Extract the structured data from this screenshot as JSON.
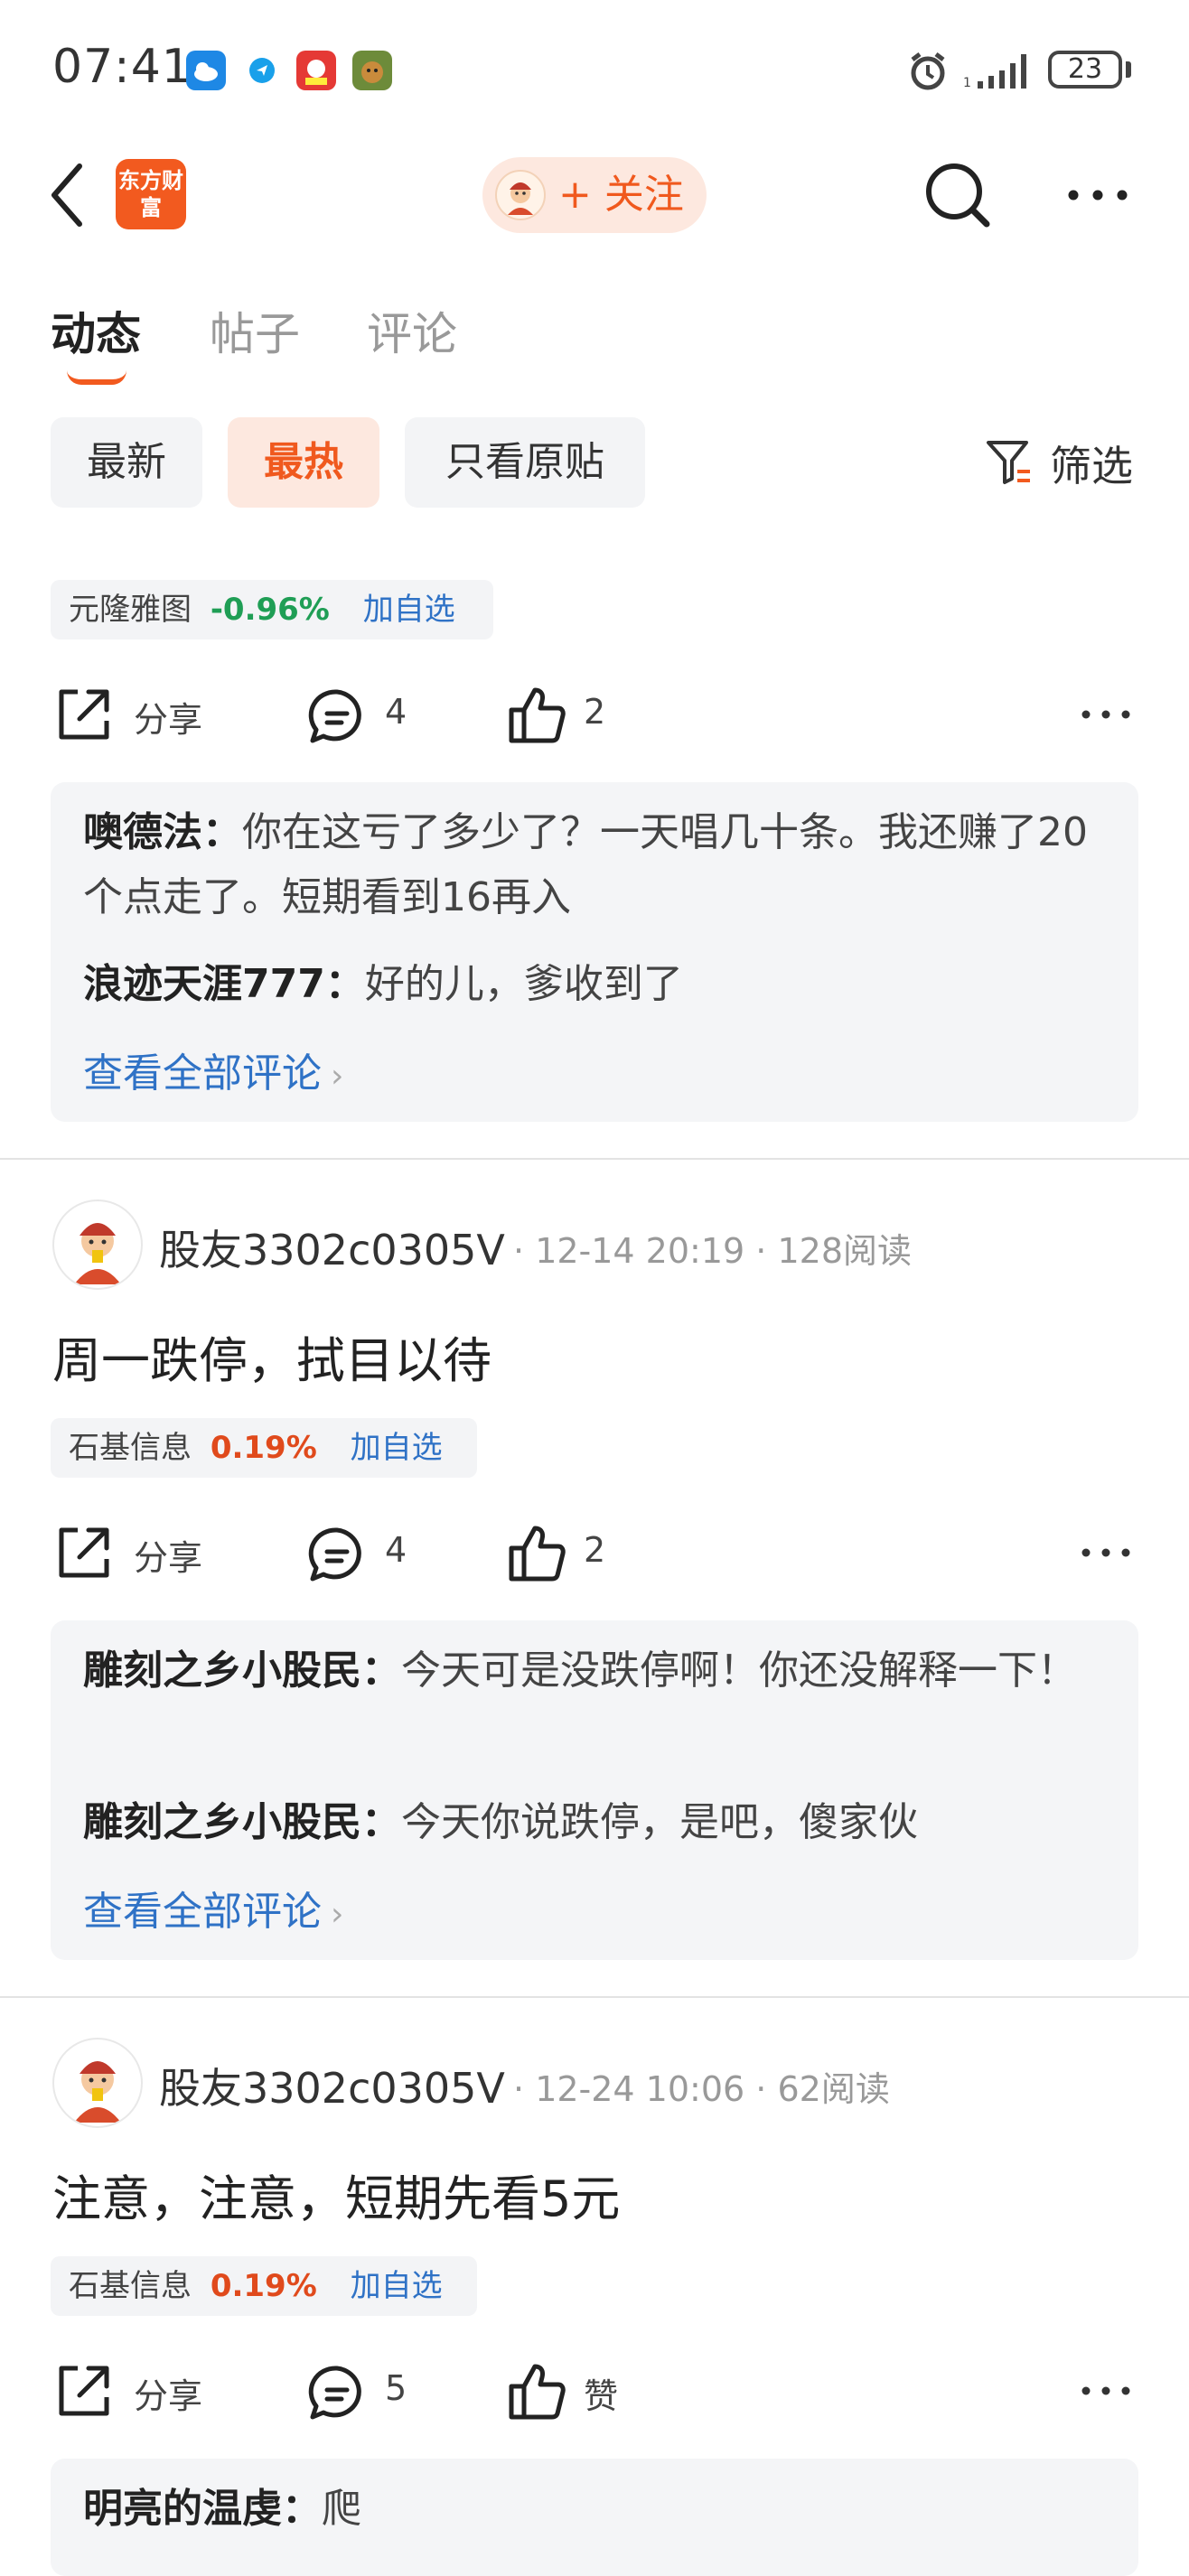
{
  "status": {
    "time": "07:41",
    "battery": "23"
  },
  "header": {
    "brand": "东方财富",
    "follow_label": "+ 关注"
  },
  "tabs": [
    "动态",
    "帖子",
    "评论"
  ],
  "chips": [
    "最新",
    "最热",
    "只看原贴"
  ],
  "filter_label": "筛选",
  "action_labels": {
    "share": "分享"
  },
  "posts": [
    {
      "stock": {
        "name": "元隆雅图",
        "change": "-0.96%",
        "add": "加自选"
      },
      "comments_count": "4",
      "likes": "2",
      "comments": [
        {
          "user": "噢德法",
          "text": "你在这亏了多少了？一天唱几十条。我还赚了20个点走了。短期看到16再入"
        },
        {
          "user": "浪迹天涯777",
          "text": "好的儿，爹收到了"
        }
      ],
      "see_all": "查看全部评论"
    },
    {
      "author": "股友3302c0305V",
      "time": "12-14 20:19",
      "reads": "128阅读",
      "title": "周一跌停，拭目以待",
      "stock": {
        "name": "石基信息",
        "change": "0.19%",
        "add": "加自选"
      },
      "comments_count": "4",
      "likes": "2",
      "comments": [
        {
          "user": "雕刻之乡小股民",
          "text": "今天可是没跌停啊！你还没解释一下！"
        },
        {
          "user": "雕刻之乡小股民",
          "text": "今天你说跌停，是吧，傻家伙"
        }
      ],
      "see_all": "查看全部评论"
    },
    {
      "author": "股友3302c0305V",
      "time": "12-24 10:06",
      "reads": "62阅读",
      "title": "注意，注意，短期先看5元",
      "stock": {
        "name": "石基信息",
        "change": "0.19%",
        "add": "加自选"
      },
      "comments_count": "5",
      "likes": "赞",
      "comments": [
        {
          "user": "明亮的温虔",
          "text": "爬"
        }
      ]
    }
  ],
  "colors": {
    "accent": "#f25a1f",
    "link": "#2f72c6",
    "down": "#1f9e55",
    "up": "#e04a1c"
  }
}
